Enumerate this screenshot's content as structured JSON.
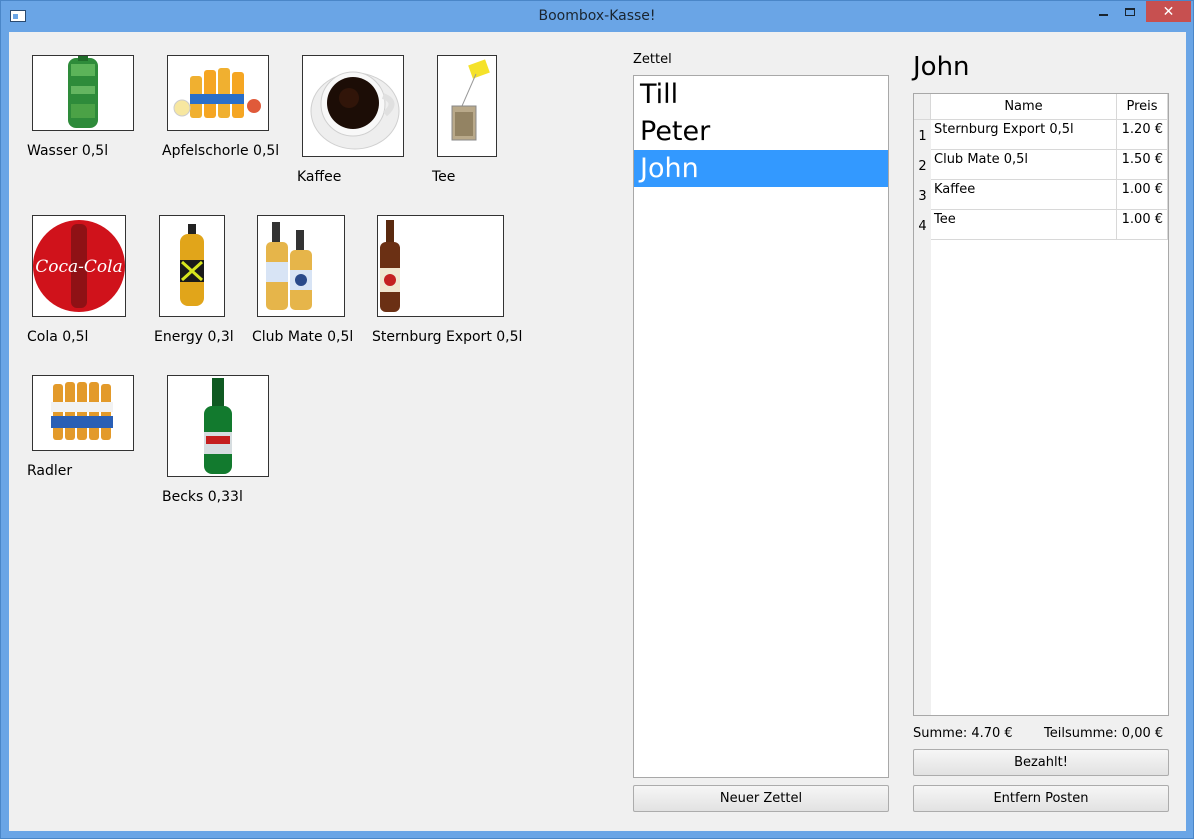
{
  "window": {
    "title": "Boombox-Kasse!"
  },
  "products": [
    {
      "label": "Wasser 0,5l",
      "icon": "water-bottle-icon"
    },
    {
      "label": "Apfelschorle 0,5l",
      "icon": "apfelschorle-bottles-icon"
    },
    {
      "label": "Kaffee",
      "icon": "coffee-cup-icon"
    },
    {
      "label": "Tee",
      "icon": "tea-bag-icon"
    },
    {
      "label": "Cola 0,5l",
      "icon": "coca-cola-logo-icon"
    },
    {
      "label": "Energy 0,3l",
      "icon": "energy-drink-bottle-icon"
    },
    {
      "label": "Club Mate 0,5l",
      "icon": "club-mate-bottles-icon"
    },
    {
      "label": "Sternburg Export 0,5l",
      "icon": "beer-bottle-icon"
    },
    {
      "label": "Radler",
      "icon": "radler-six-pack-icon"
    },
    {
      "label": "Becks 0,33l",
      "icon": "becks-bottle-icon"
    }
  ],
  "zettel": {
    "label": "Zettel",
    "items": [
      "Till",
      "Peter",
      "John"
    ],
    "selected": "John",
    "new_button": "Neuer Zettel"
  },
  "detail": {
    "name": "John",
    "columns": [
      "Name",
      "Preis"
    ],
    "rows": [
      {
        "num": "1",
        "name": "Sternburg Export 0,5l",
        "price": "1.20 €"
      },
      {
        "num": "2",
        "name": "Club Mate 0,5l",
        "price": "1.50 €"
      },
      {
        "num": "3",
        "name": "Kaffee",
        "price": "1.00 €"
      },
      {
        "num": "4",
        "name": "Tee",
        "price": "1.00 €"
      }
    ],
    "summe": "Summe: 4.70 €",
    "teilsumme": "Teilsumme: 0,00 €",
    "paid_button": "Bezahlt!",
    "remove_button": "Entfern Posten"
  },
  "colors": {
    "selection": "#3399ff",
    "titlebar": "#6aa5e6",
    "close": "#c75050"
  }
}
